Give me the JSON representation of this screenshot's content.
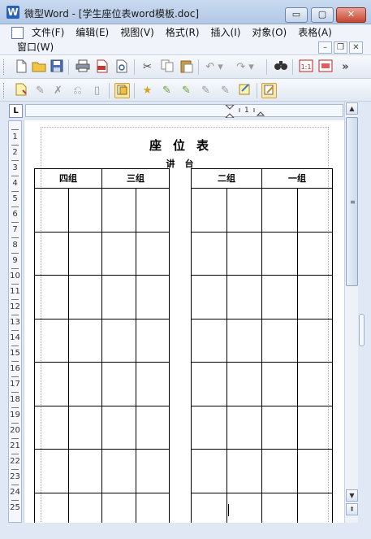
{
  "window": {
    "title": "微型Word - [学生座位表word模板.doc]",
    "app_icon_letter": "W",
    "min_symbol": "▭",
    "max_symbol": "▢",
    "close_symbol": "✕"
  },
  "menu": {
    "items": [
      "文件(F)",
      "编辑(E)",
      "视图(V)",
      "格式(R)",
      "插入(I)",
      "对象(O)",
      "表格(A)"
    ],
    "second_row": "窗口(W)",
    "mdi_min": "–",
    "mdi_restore": "❐",
    "mdi_close": "✕"
  },
  "toolbar1": {
    "more_symbol": "»",
    "icons": [
      "new-file-icon",
      "open-folder-icon",
      "save-icon",
      "print-icon",
      "pdf-icon",
      "print-preview-icon",
      "cut-icon",
      "copy-icon",
      "paste-icon",
      "undo-icon",
      "redo-icon",
      "find-icon",
      "actual-size-icon",
      "page-view-icon"
    ]
  },
  "toolbar2": {
    "icons": [
      "insert-note-icon",
      "edit-icon",
      "delete-icon",
      "reject-icon",
      "accept-icon",
      "track-changes-icon",
      "star-icon",
      "pencil-1-icon",
      "pencil-2-icon",
      "pencil-3-icon",
      "pencil-4-icon",
      "notes-icon",
      "review-icon"
    ]
  },
  "ruler": {
    "tab_selector": "L",
    "hmark": "1"
  },
  "vruler": {
    "numbers": [
      "1",
      "2",
      "3",
      "4",
      "5",
      "6",
      "7",
      "8",
      "9",
      "10",
      "11",
      "12",
      "13",
      "14",
      "15",
      "16",
      "17",
      "18",
      "19",
      "20",
      "21",
      "22",
      "23",
      "24",
      "25"
    ]
  },
  "document": {
    "title": "座位表",
    "subtitle": "讲台",
    "left_groups": [
      "四组",
      "三组"
    ],
    "right_groups": [
      "二组",
      "一组"
    ]
  },
  "scrollbar": {
    "up": "▲",
    "down": "▼",
    "prev_page": "⇞",
    "grip": "≡"
  }
}
